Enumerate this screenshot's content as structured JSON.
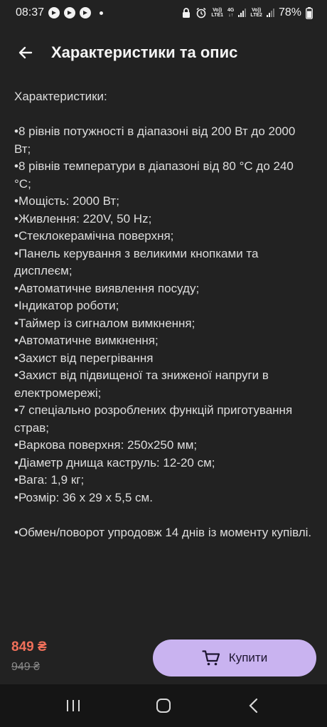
{
  "status_bar": {
    "time": "08:37",
    "net_label_1_top": "Vo))",
    "net_label_1_bottom": "LTE1",
    "net_label_2_top": "4G",
    "net_label_3_top": "Vo))",
    "net_label_3_bottom": "LTE2",
    "battery": "78%"
  },
  "header": {
    "title": "Характеристики та опис"
  },
  "description": {
    "heading": "Характеристики:",
    "items": [
      "•8 рівнів потужності в діапазоні від 200 Вт до 2000 Вт;",
      "•8 рівнів температури в діапазоні від 80 °С до 240 °С;",
      "•Мощість: 2000 Вт;",
      "•Живлення: 220V, 50 Hz;",
      "•Стеклокерамічна поверхня;",
      "•Панель керування з великими кнопками та дисплеєм;",
      "•Автоматичне виявлення посуду;",
      "•Індикатор роботи;",
      "•Таймер із сигналом вимкнення;",
      "•Автоматичне вимкнення;",
      "•Захист від перегрівання",
      "•Захист від підвищеної та зниженої напруги в електромережі;",
      "•7 спеціально розроблених функцій приготування страв;",
      "•Варкова поверхня: 250x250 мм;",
      "•Діаметр днища каструль: 12-20 см;",
      "•Вага: 1,9 кг;",
      "•Розмір: 36 х 29 х 5,5 см."
    ],
    "footer_note": "•Обмен/поворот упродовж 14 днів із моменту купівлі."
  },
  "purchase": {
    "price": "849 ₴",
    "old_price": "949 ₴",
    "buy_label": "Купити"
  },
  "colors": {
    "background": "#222222",
    "accent_button": "#c9b3f0",
    "price": "#f0705a"
  }
}
